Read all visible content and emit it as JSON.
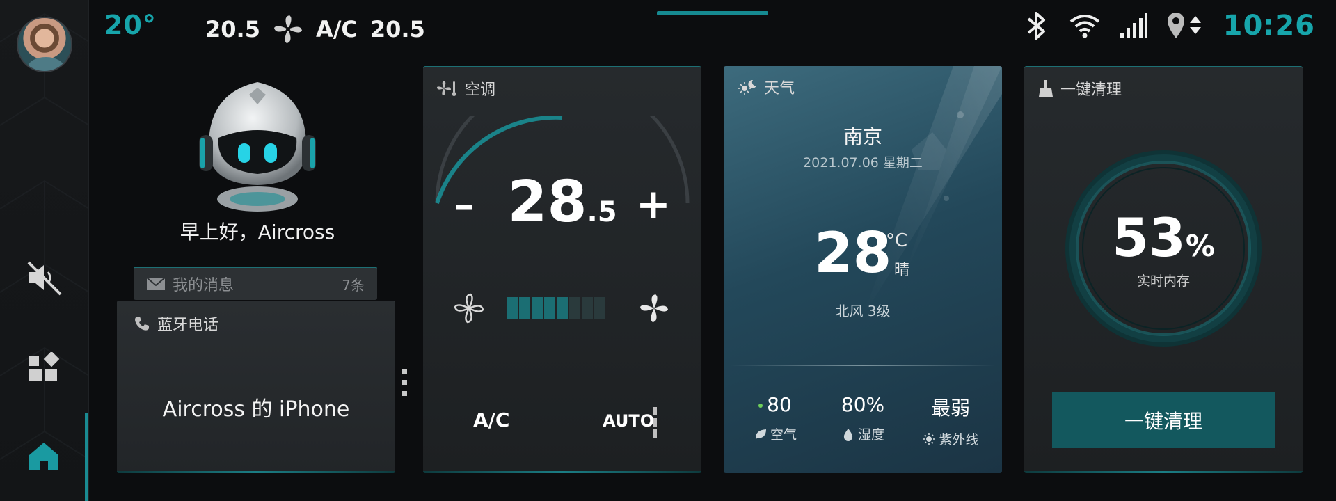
{
  "status_bar": {
    "outside_temp": "20°",
    "climate_left_temp": "20.5",
    "climate_label": "A/C",
    "climate_right_temp": "20.5",
    "clock": "10:26",
    "icons": [
      "bluetooth-icon",
      "wifi-icon",
      "signal-icon",
      "location-icon"
    ]
  },
  "sidebar": {
    "items": [
      {
        "name": "avatar"
      },
      {
        "name": "mute-icon"
      },
      {
        "name": "apps-icon"
      },
      {
        "name": "home-icon",
        "active": true
      }
    ]
  },
  "assistant": {
    "greeting": "早上好，Aircross"
  },
  "messages": {
    "label": "我的消息",
    "count": "7条"
  },
  "bluetooth_phone": {
    "title": "蓝牙电话",
    "device": "Aircross 的 iPhone"
  },
  "ac_card": {
    "title": "空调",
    "temp_int": "28",
    "temp_dec": ".5",
    "minus": "–",
    "plus": "+",
    "fan_level": 5,
    "fan_max": 8,
    "mode_ac": "A/C",
    "mode_auto": "AUTO"
  },
  "weather_card": {
    "title": "天气",
    "city": "南京",
    "date": "2021.07.06 星期二",
    "temp": "28",
    "unit": "°C",
    "condition": "晴",
    "wind": "北风 3级",
    "air_value": "80",
    "air_label": "空气",
    "humidity_value": "80%",
    "humidity_label": "湿度",
    "uv_value": "最弱",
    "uv_label": "紫外线"
  },
  "clean_card": {
    "title": "一键清理",
    "memory_value": "53",
    "memory_unit": "%",
    "memory_label": "实时内存",
    "button_label": "一键清理"
  },
  "colors": {
    "accent": "#17a5ab",
    "button": "#13585e",
    "background": "#0c0d0f"
  }
}
